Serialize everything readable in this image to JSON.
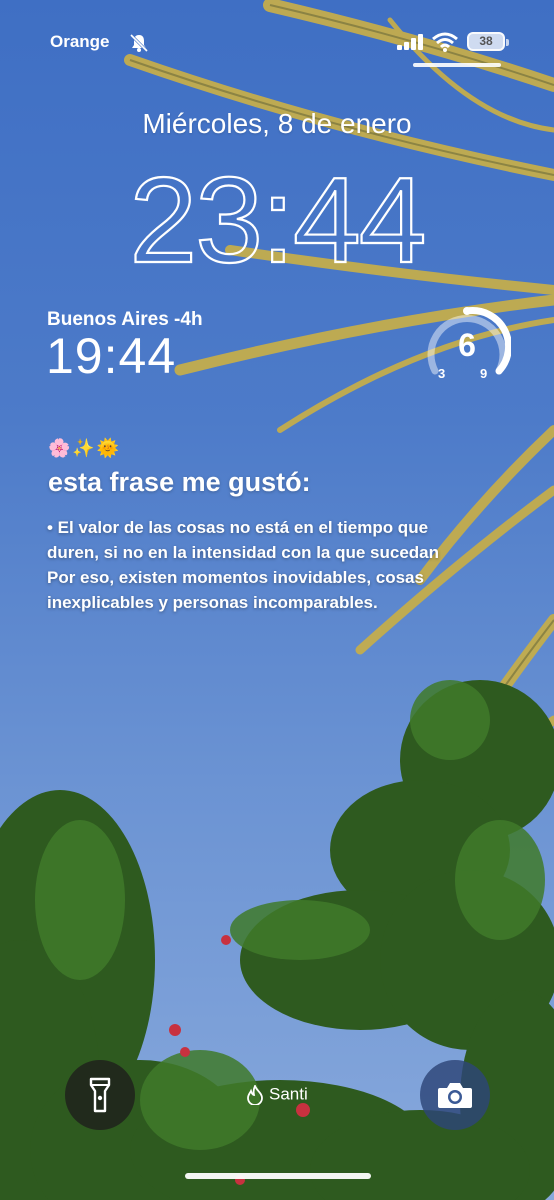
{
  "status_bar": {
    "carrier": "Orange",
    "battery": "38",
    "icons": [
      "bell-slash-icon",
      "signal-icon",
      "wifi-icon",
      "battery-icon"
    ]
  },
  "lock_screen": {
    "date": "Miércoles, 8 de enero",
    "time": "23:44"
  },
  "widgets": {
    "world_clock": {
      "city": "Buenos Aires -4h",
      "time": "19:44"
    },
    "gauge": {
      "value": "6",
      "min": "3",
      "max": "9"
    }
  },
  "note": {
    "emojis": "🌸✨🌞",
    "title": "esta frase me gustó:",
    "lines": [
      "• El valor de las cosas no está en el tiempo que",
      "duren, si no en la intensidad con la que sucedan",
      "Por eso, existen momentos inovidables, cosas",
      "inexplicables y personas incomparables."
    ]
  },
  "bottom": {
    "owner": "Santi",
    "flashlight_icon": "flashlight-icon",
    "camera_icon": "camera-icon"
  },
  "colors": {
    "sky": "#4d7bc9",
    "palm": "#c9b24a",
    "foliage": "#2f5a1f",
    "flower": "#c8313f"
  }
}
